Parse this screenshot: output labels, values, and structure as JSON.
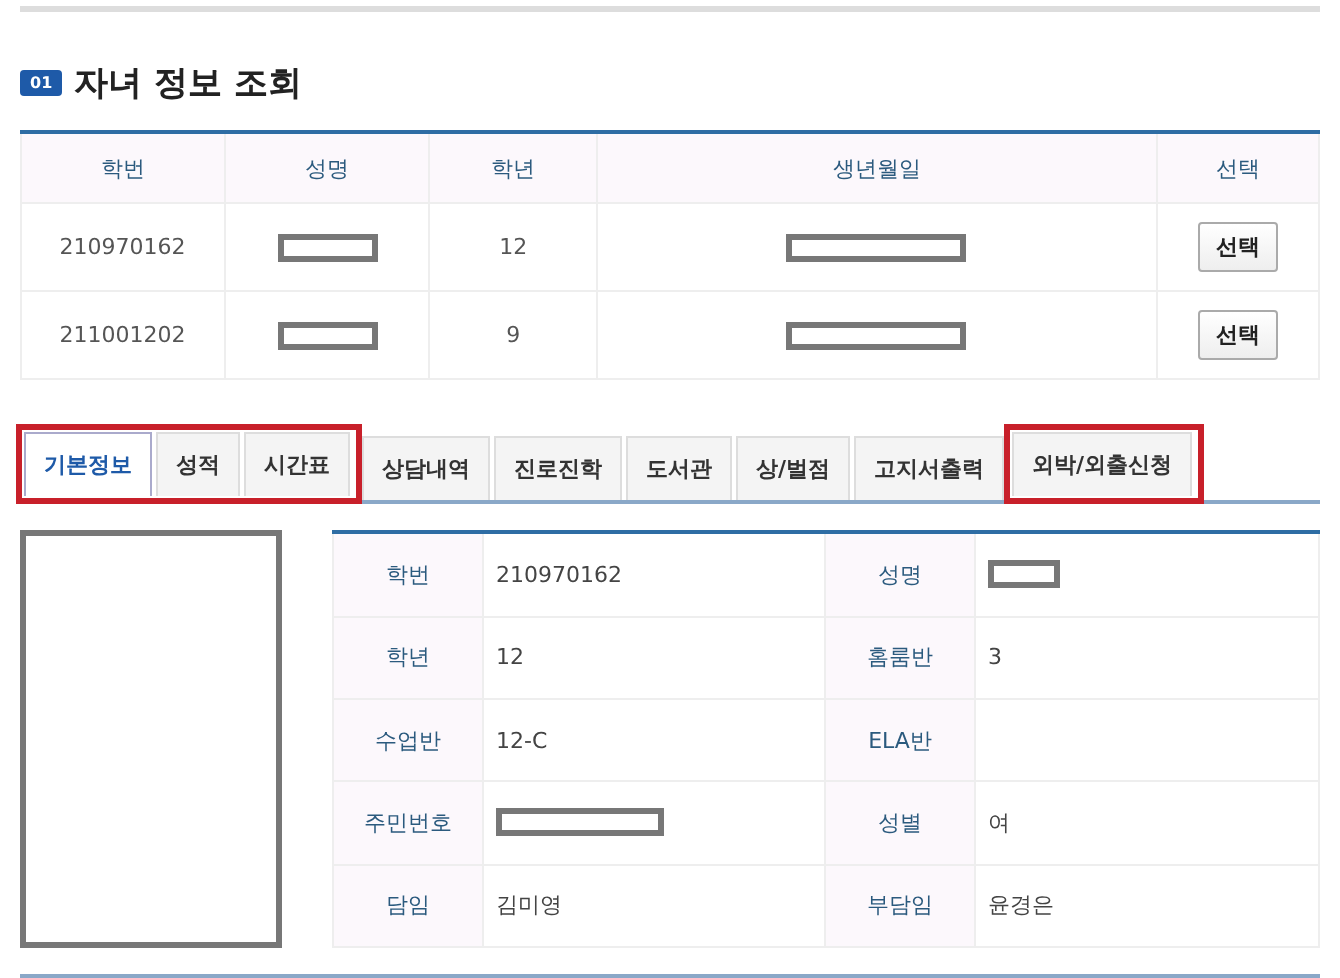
{
  "section": {
    "number": "01",
    "title": "자녀 정보 조회"
  },
  "children_table": {
    "columns": [
      "학번",
      "성명",
      "학년",
      "생년월일",
      "선택"
    ],
    "rows": [
      {
        "student_id": "210970162",
        "name_redacted": true,
        "grade": "12",
        "birth_redacted": true,
        "button": "선택"
      },
      {
        "student_id": "211001202",
        "name_redacted": true,
        "grade": "9",
        "birth_redacted": true,
        "button": "선택"
      }
    ]
  },
  "tabs": [
    {
      "label": "기본정보",
      "selected": true,
      "highlighted": true
    },
    {
      "label": "성적",
      "selected": false,
      "highlighted": true
    },
    {
      "label": "시간표",
      "selected": false,
      "highlighted": true
    },
    {
      "label": "상담내역",
      "selected": false,
      "highlighted": false
    },
    {
      "label": "진로진학",
      "selected": false,
      "highlighted": false
    },
    {
      "label": "도서관",
      "selected": false,
      "highlighted": false
    },
    {
      "label": "상/벌점",
      "selected": false,
      "highlighted": false
    },
    {
      "label": "고지서출력",
      "selected": false,
      "highlighted": false
    },
    {
      "label": "외박/외출신청",
      "selected": false,
      "highlighted": true
    }
  ],
  "info": [
    [
      {
        "label": "학번",
        "value": "210970162"
      },
      {
        "label": "성명",
        "redacted": true
      }
    ],
    [
      {
        "label": "학년",
        "value": "12"
      },
      {
        "label": "홈룸반",
        "value": "3"
      }
    ],
    [
      {
        "label": "수업반",
        "value": "12-C"
      },
      {
        "label": "ELA반"
      }
    ],
    [
      {
        "label": "주민번호",
        "redacted": true
      },
      {
        "label": "성별",
        "value": "여"
      }
    ],
    [
      {
        "label": "담임",
        "value": "김미영"
      },
      {
        "label": "부담임",
        "value": "윤경은"
      }
    ]
  ]
}
